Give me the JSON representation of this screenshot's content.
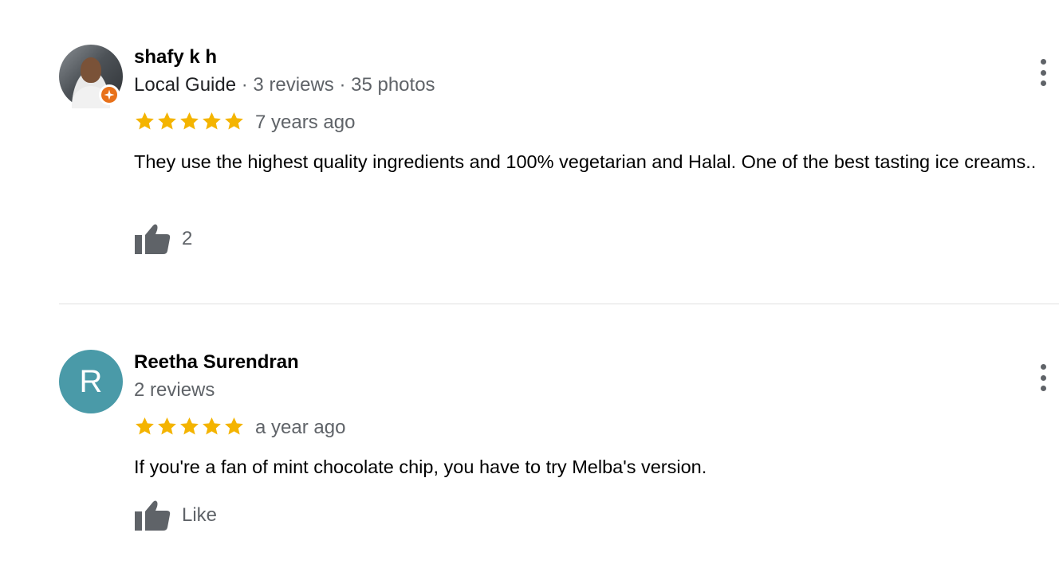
{
  "reviews": [
    {
      "name": "shafy k h",
      "guide_label": "Local Guide",
      "review_count": "3 reviews",
      "photo_count": "35 photos",
      "separator": " · ",
      "rating": 5,
      "time": "7 years ago",
      "text": "They use the highest quality ingredients and 100% vegetarian and Halal. One of the best tasting ice creams..",
      "likes": "2",
      "avatar_type": "photo",
      "badge_icon": "local-guide-star-icon"
    },
    {
      "name": "Reetha Surendran",
      "review_count": "2 reviews",
      "rating": 5,
      "time": "a year ago",
      "text": "If you're a fan of mint chocolate chip, you have to try Melba's version.",
      "likes": "Like",
      "avatar_type": "letter",
      "avatar_letter": "R"
    }
  ],
  "colors": {
    "star": "#F4B400",
    "thumb": "#5f6368",
    "avatar_letter_bg": "#4a9aa8",
    "guide_badge": "#e8711a"
  },
  "icons": {
    "star": "star-icon",
    "thumb": "thumbs-up-icon",
    "menu": "more-vert-icon"
  }
}
